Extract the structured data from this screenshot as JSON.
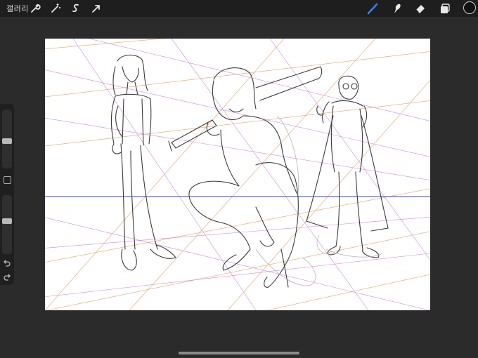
{
  "topbar": {
    "gallery_label": "갤러리",
    "actions_icon": "wrench-icon",
    "adjustments_icon": "magic-wand-icon",
    "selection_icon": "selection-s-icon",
    "transform_icon": "arrow-cursor-icon",
    "brush_icon": "brush-icon",
    "smudge_icon": "smudge-icon",
    "eraser_icon": "eraser-icon",
    "layers_icon": "layers-icon",
    "active_tool": "brush",
    "accent_color": "#3d7cf5",
    "current_color": "#111111"
  },
  "sidebar": {
    "brush_size_icon": "size-slider",
    "opacity_icon": "opacity-slider",
    "modify_icon": "square-icon",
    "undo_icon": "undo-icon",
    "redo_icon": "redo-icon"
  },
  "canvas": {
    "background": "#ffffff",
    "horizon_color": "#3b3bd6",
    "grid_colors": [
      "#d98a4a",
      "#c46fd2"
    ]
  }
}
